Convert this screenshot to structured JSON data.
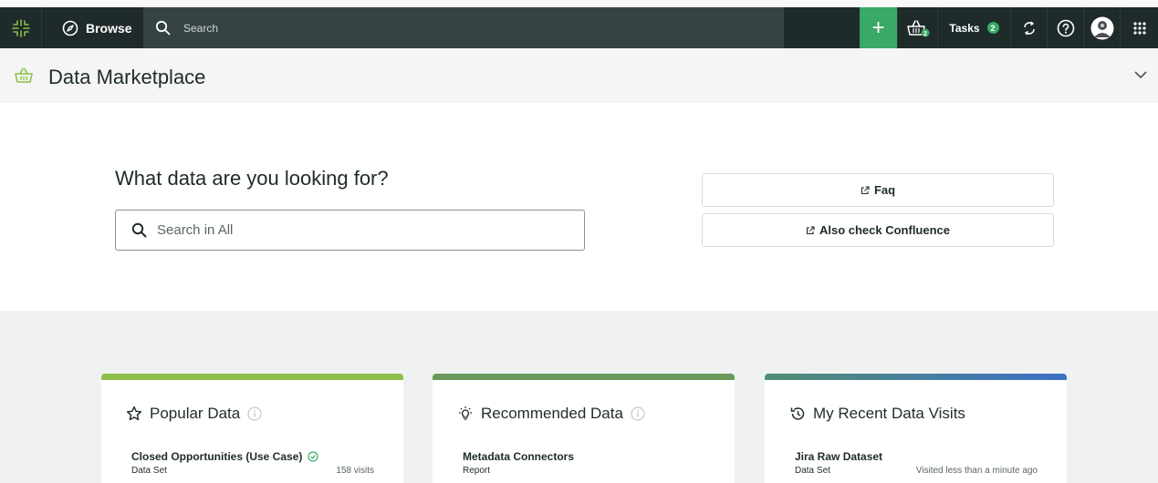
{
  "topbar": {
    "browse_label": "Browse",
    "search_placeholder": "Search",
    "plus_label": "+",
    "basket_count": "2",
    "tasks_label": "Tasks",
    "tasks_count": "2"
  },
  "header": {
    "title": "Data Marketplace"
  },
  "hero": {
    "question": "What data are you looking for?",
    "search_placeholder": "Search in All",
    "faq_label": "Faq",
    "confluence_label": "Also check Confluence"
  },
  "cards": [
    {
      "title": "Popular Data",
      "item_title": "Closed Opportunities (Use Case)",
      "item_type": "Data Set",
      "item_meta": "158 visits"
    },
    {
      "title": "Recommended Data",
      "item_title": "Metadata Connectors",
      "item_type": "Report",
      "item_meta": ""
    },
    {
      "title": "My Recent Data Visits",
      "item_title": "Jira Raw Dataset",
      "item_type": "Data Set",
      "item_meta": "Visited less than a minute ago"
    }
  ],
  "colors": {
    "accent_green": "#3aa866",
    "topbar": "#364343",
    "card1_bar": "#8cc04a",
    "card2_bar": "#6a9a5a",
    "card3_bar_end": "#3f6fc6"
  }
}
